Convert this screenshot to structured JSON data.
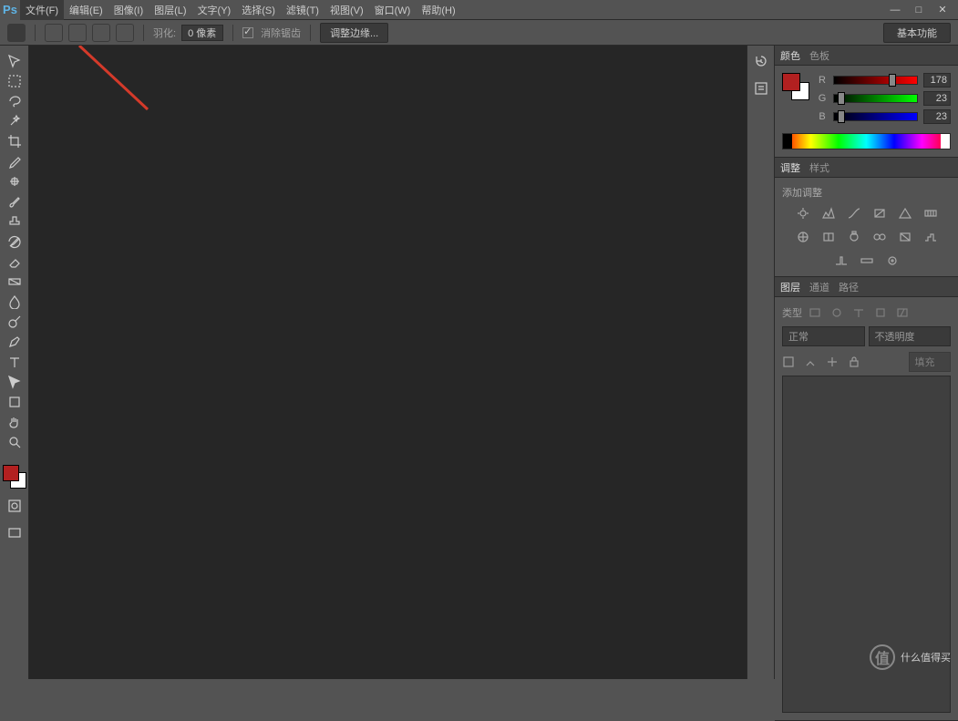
{
  "app": {
    "logo": "Ps"
  },
  "menu": {
    "file": "文件(F)",
    "edit": "编辑(E)",
    "image": "图像(I)",
    "layer": "图层(L)",
    "type": "文字(Y)",
    "select": "选择(S)",
    "filter": "滤镜(T)",
    "view": "视图(V)",
    "window": "窗口(W)",
    "help": "帮助(H)"
  },
  "options": {
    "transform_label": "羽化:",
    "feather_value": "0 像素",
    "antialias_label": "消除锯齿",
    "adjust_edge": "调整边缘...",
    "essentials": "基本功能"
  },
  "panels": {
    "color": {
      "tab_color": "颜色",
      "tab_swatches": "色板",
      "r": "R",
      "g": "G",
      "b": "B",
      "r_val": "178",
      "g_val": "23",
      "b_val": "23"
    },
    "adjustments": {
      "tab_adj": "调整",
      "tab_styles": "样式",
      "add_label": "添加调整"
    },
    "layers": {
      "tab_layers": "图层",
      "tab_channels": "通道",
      "tab_paths": "路径",
      "blend": "正常",
      "opacity_label": "不透明度",
      "fill_label": "填充",
      "filter_kind": "类型"
    }
  },
  "colors": {
    "fg": "#b22020",
    "bg": "#ffffff"
  },
  "watermark": {
    "circle": "值",
    "text": "什么值得买"
  }
}
